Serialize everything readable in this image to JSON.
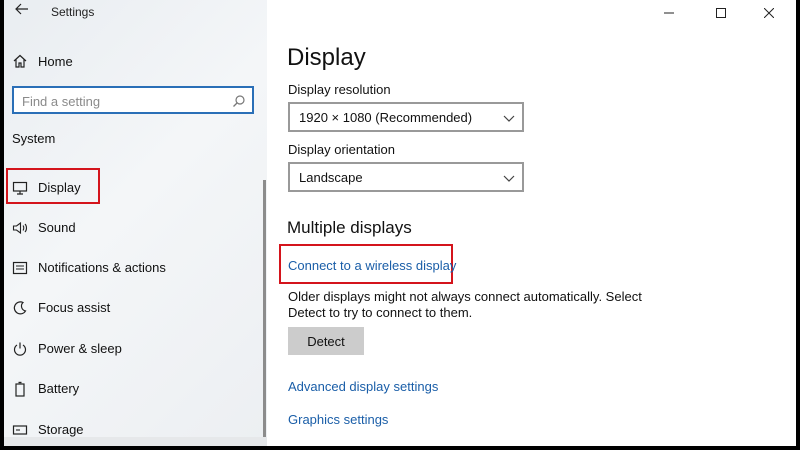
{
  "window": {
    "title": "Settings",
    "controls": [
      "minimize",
      "maximize",
      "close"
    ]
  },
  "sidebar": {
    "home_label": "Home",
    "search": {
      "placeholder": "Find a setting",
      "value": ""
    },
    "section": "System",
    "items": [
      {
        "label": "Display",
        "icon": "monitor-icon",
        "selected": true
      },
      {
        "label": "Sound",
        "icon": "speaker-icon"
      },
      {
        "label": "Notifications & actions",
        "icon": "notification-icon"
      },
      {
        "label": "Focus assist",
        "icon": "moon-icon"
      },
      {
        "label": "Power & sleep",
        "icon": "power-icon"
      },
      {
        "label": "Battery",
        "icon": "battery-icon"
      },
      {
        "label": "Storage",
        "icon": "storage-icon"
      }
    ]
  },
  "main": {
    "title": "Display",
    "resolution": {
      "label": "Display resolution",
      "value": "1920 × 1080 (Recommended)"
    },
    "orientation": {
      "label": "Display orientation",
      "value": "Landscape"
    },
    "multiple_displays": {
      "heading": "Multiple displays",
      "wireless_link": "Connect to a wireless display",
      "description": "Older displays might not always connect automatically. Select Detect to try to connect to them.",
      "detect_button": "Detect"
    },
    "links": {
      "advanced": "Advanced display settings",
      "graphics": "Graphics settings"
    }
  },
  "colors": {
    "accent": "#1a5ea8",
    "highlight_box": "#d4141c",
    "search_border": "#2a6fb7"
  }
}
